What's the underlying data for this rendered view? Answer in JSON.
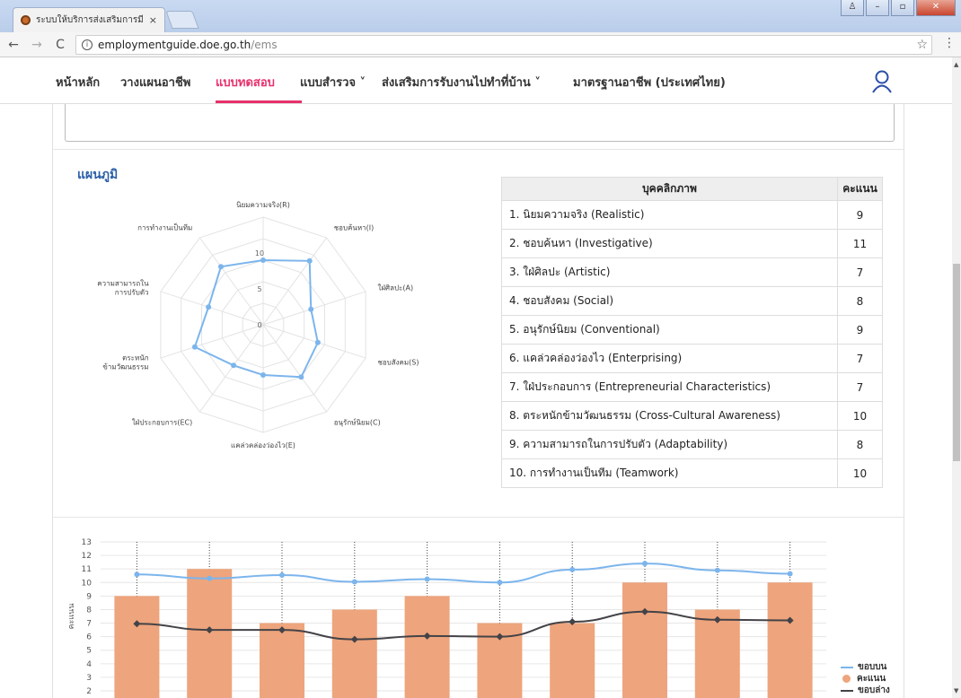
{
  "browser": {
    "tab_title": "ระบบให้บริการส่งเสริมการมีงา",
    "tab_close": "×",
    "url_host": "employmentguide.doe.go.th",
    "url_path": "/ems",
    "back": "←",
    "forward": "→",
    "reload": "C",
    "star": "☆",
    "menu": "⋮"
  },
  "nav": {
    "home": "หน้าหลัก",
    "plan": "วางแผนอาชีพ",
    "test": "แบบทดสอบ",
    "survey": "แบบสำรวจ ˅",
    "promote": "ส่งเสริมการรับงานไปทำที่บ้าน ˅",
    "standard": "มาตรฐานอาชีพ (ประเทศไทย)"
  },
  "section": {
    "title": "แผนภูมิ"
  },
  "radar": {
    "labels": [
      "นิยมความจริง(R)",
      "ชอบค้นหา(I)",
      "ใฝ่ศิลปะ(A)",
      "ชอบสังคม(S)",
      "อนุรักษ์นิยม(C)",
      "แคล่วคล่องว่องไว(E)",
      "ใฝ่ประกอบการ(EC)",
      "ตระหนัก ข้ามวัฒนธรรม",
      "ความสามารถใน การปรับตัว",
      "การทำงานเป็นทีม"
    ],
    "ticks": [
      "10",
      "5",
      "0"
    ],
    "values": [
      9,
      11,
      7,
      8,
      9,
      7,
      7,
      10,
      8,
      10
    ],
    "max": 15,
    "color": "#7cb5ec"
  },
  "table": {
    "header_personality": "บุคคลิกภาพ",
    "header_score": "คะแนน",
    "rows": [
      {
        "name": "1. นิยมความจริง (Realistic)",
        "score": "9"
      },
      {
        "name": "2. ชอบค้นหา (Investigative)",
        "score": "11"
      },
      {
        "name": "3. ใฝ่ศิลปะ (Artistic)",
        "score": "7"
      },
      {
        "name": "4. ชอบสังคม (Social)",
        "score": "8"
      },
      {
        "name": "5. อนุรักษ์นิยม (Conventional)",
        "score": "9"
      },
      {
        "name": "6. แคล่วคล่องว่องไว (Enterprising)",
        "score": "7"
      },
      {
        "name": "7. ใฝ่ประกอบการ (Entrepreneurial Characteristics)",
        "score": "7"
      },
      {
        "name": "8. ตระหนักข้ามวัฒนธรรม (Cross-Cultural Awareness)",
        "score": "10"
      },
      {
        "name": "9. ความสามารถในการปรับตัว (Adaptability)",
        "score": "8"
      },
      {
        "name": "10. การทำงานเป็นทีม (Teamwork)",
        "score": "10"
      }
    ]
  },
  "chart_data": {
    "type": "bar",
    "ylabel": "คะแนน",
    "ylim": [
      2,
      13
    ],
    "yticks": [
      13,
      12,
      11,
      10,
      9,
      8,
      7,
      6,
      5,
      4,
      3,
      2
    ],
    "grid": true,
    "legend_position": "bottom-right",
    "series": [
      {
        "name": "ขอบบน",
        "type": "line",
        "color": "#7cb5ec",
        "values": [
          10.6,
          10.3,
          10.55,
          10.05,
          10.25,
          10.0,
          10.95,
          11.4,
          10.9,
          10.65
        ]
      },
      {
        "name": "คะแนน",
        "type": "bar",
        "color": "#eea47c",
        "values": [
          9,
          11,
          7,
          8,
          9,
          7,
          7,
          10,
          8,
          10
        ]
      },
      {
        "name": "ขอบล่าง",
        "type": "line",
        "color": "#434348",
        "values": [
          6.95,
          6.5,
          6.5,
          5.8,
          6.05,
          6.0,
          7.1,
          7.85,
          7.25,
          7.2
        ]
      }
    ]
  }
}
